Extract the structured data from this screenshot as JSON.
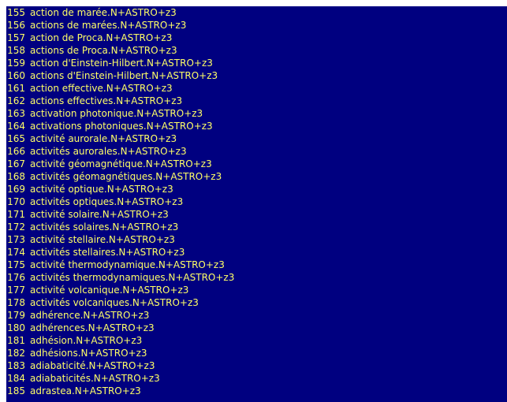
{
  "colors": {
    "background": "#000080",
    "text": "#ffff66",
    "page": "#ffffff"
  },
  "entries": [
    {
      "n": "155",
      "text": "action de marée.N+ASTRO+z3"
    },
    {
      "n": "156",
      "text": "actions de marées.N+ASTRO+z3"
    },
    {
      "n": "157",
      "text": "action de Proca.N+ASTRO+z3"
    },
    {
      "n": "158",
      "text": "actions de Proca.N+ASTRO+z3"
    },
    {
      "n": "159",
      "text": "action d'Einstein-Hilbert.N+ASTRO+z3"
    },
    {
      "n": "160",
      "text": "actions d'Einstein-Hilbert.N+ASTRO+z3"
    },
    {
      "n": "161",
      "text": "action effective.N+ASTRO+z3"
    },
    {
      "n": "162",
      "text": "actions effectives.N+ASTRO+z3"
    },
    {
      "n": "163",
      "text": "activation photonique.N+ASTRO+z3"
    },
    {
      "n": "164",
      "text": "activations photoniques.N+ASTRO+z3"
    },
    {
      "n": "165",
      "text": "activité aurorale.N+ASTRO+z3"
    },
    {
      "n": "166",
      "text": "activités aurorales.N+ASTRO+z3"
    },
    {
      "n": "167",
      "text": "activité géomagnétique.N+ASTRO+z3"
    },
    {
      "n": "168",
      "text": "activités géomagnétiques.N+ASTRO+z3"
    },
    {
      "n": "169",
      "text": "activité optique.N+ASTRO+z3"
    },
    {
      "n": "170",
      "text": "activités optiques.N+ASTRO+z3"
    },
    {
      "n": "171",
      "text": "activité solaire.N+ASTRO+z3"
    },
    {
      "n": "172",
      "text": "activités solaires.N+ASTRO+z3"
    },
    {
      "n": "173",
      "text": "activité stellaire.N+ASTRO+z3"
    },
    {
      "n": "174",
      "text": "activités stellaires.N+ASTRO+z3"
    },
    {
      "n": "175",
      "text": "activité thermodynamique.N+ASTRO+z3"
    },
    {
      "n": "176",
      "text": "activités thermodynamiques.N+ASTRO+z3"
    },
    {
      "n": "177",
      "text": "activité volcanique.N+ASTRO+z3"
    },
    {
      "n": "178",
      "text": "activités volcaniques.N+ASTRO+z3"
    },
    {
      "n": "179",
      "text": "adhérence.N+ASTRO+z3"
    },
    {
      "n": "180",
      "text": "adhérences.N+ASTRO+z3"
    },
    {
      "n": "181",
      "text": "adhésion.N+ASTRO+z3"
    },
    {
      "n": "182",
      "text": "adhésions.N+ASTRO+z3"
    },
    {
      "n": "183",
      "text": "adiabaticité.N+ASTRO+z3"
    },
    {
      "n": "184",
      "text": "adiabaticités.N+ASTRO+z3"
    },
    {
      "n": "185",
      "text": "adrastea.N+ASTRO+z3"
    }
  ]
}
